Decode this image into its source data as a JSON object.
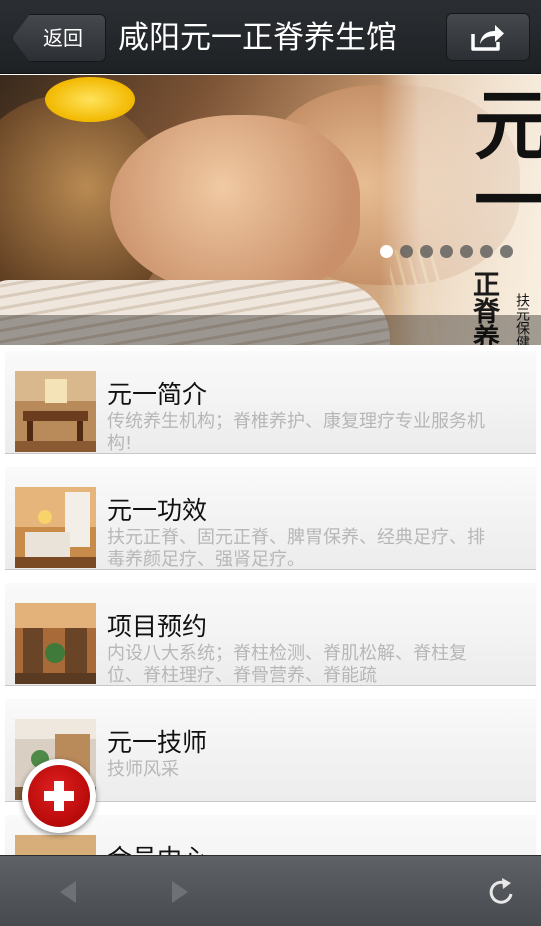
{
  "header": {
    "back_label": "返回",
    "title": "咸阳元一正脊养生馆",
    "share_icon": "share-icon"
  },
  "banner": {
    "logo_main": "元一",
    "logo_sub": "正脊养生馆",
    "logo_small": "扶元保健按摩",
    "slide_count": 7,
    "active_slide": 1
  },
  "list": {
    "items": [
      {
        "title": "元一简介",
        "desc": "传统养生机构；脊椎养护、康复理疗专业服务机构!"
      },
      {
        "title": "元一功效",
        "desc": "扶元正脊、固元正脊、脾胃保养、经典足疗、排毒养颜足疗、强肾足疗。"
      },
      {
        "title": "项目预约",
        "desc": "内设八大系统；脊柱检测、脊肌松解、脊柱复位、脊柱理疗、脊骨营养、脊能疏"
      },
      {
        "title": "元一技师",
        "desc": "技师风采"
      },
      {
        "title": "会员中心",
        "desc": ""
      }
    ]
  },
  "toolbar": {
    "back_icon": "arrow-left-icon",
    "forward_icon": "arrow-right-icon",
    "refresh_icon": "refresh-icon"
  },
  "colors": {
    "header_bg": "#2b2f33",
    "toolbar_bg": "#55595d",
    "desc_text": "#b7b7b7",
    "fab_red": "#c40000"
  }
}
